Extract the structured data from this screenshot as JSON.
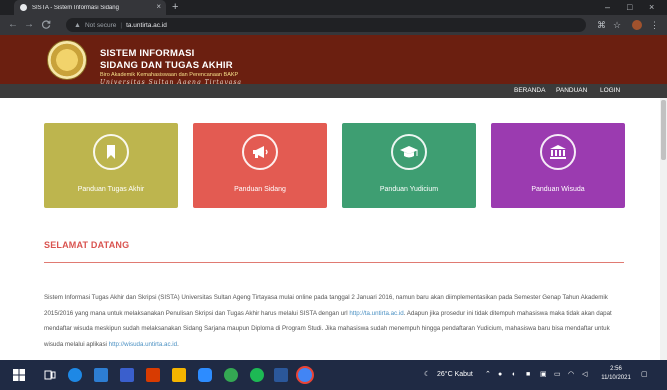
{
  "browser": {
    "tab_title": "SISTA - Sistem Informasi Sidang",
    "tab_close": "×",
    "new_tab": "+",
    "back": "←",
    "forward": "→",
    "reload": "C",
    "security_icon": "warning-triangle-icon",
    "security_label": "Not secure",
    "separator": "|",
    "url": "ta.untirta.ac.id",
    "minimize": "–",
    "maximize": "□",
    "close": "×"
  },
  "site": {
    "title_line1": "SISTEM INFORMASI",
    "title_line2": "SIDANG DAN TUGAS AKHIR",
    "subtitle": "Biro Akademik Kemahasiswaan dan Perencanaan BAKP",
    "university": "Universitas Sultan Ageng Tirtayasa"
  },
  "nav": {
    "items": [
      {
        "label": "BERANDA"
      },
      {
        "label": "PANDUAN"
      },
      {
        "label": "LOGIN"
      }
    ]
  },
  "cards": [
    {
      "label": "Panduan Tugas Akhir",
      "icon": "bookmark-icon",
      "color": "#bdb54e"
    },
    {
      "label": "Panduan Sidang",
      "icon": "megaphone-icon",
      "color": "#e35b52"
    },
    {
      "label": "Panduan Yudicium",
      "icon": "graduation-cap-icon",
      "color": "#3e9e72"
    },
    {
      "label": "Panduan Wisuda",
      "icon": "institution-icon",
      "color": "#9b3bb0"
    }
  ],
  "welcome": {
    "heading": "SELAMAT DATANG",
    "para_part1": "Sistem Informasi Tugas Akhir dan Skripsi (SISTA) Universitas Sultan Ageng Tirtayasa mulai online pada tanggal 2 Januari 2016, namun baru akan diimplementasikan pada Semester Genap Tahun Akademik 2015/2016 yang mana untuk melaksanakan Penulisan Skripsi dan Tugas Akhir harus melalui SISTA dengan url ",
    "link1": "http://ta.untirta.ac.id",
    "para_part2": ". Adapun jika prosedur ini tidak ditempuh mahasiswa maka tidak akan dapat mendaftar wisuda meskipun sudah melaksanakan Sidang Sarjana maupun Diploma di Program Studi. Jika mahasiswa sudah menempuh hingga pendaftaran Yudicium, mahasiswa baru bisa mendaftar untuk wisuda melalui aplikasi ",
    "link2": "http://wisuda.untirta.ac.id",
    "para_part3": "."
  },
  "taskbar": {
    "weather": "26°C Kabut",
    "time": "2:56",
    "date": "11/10/2021"
  }
}
